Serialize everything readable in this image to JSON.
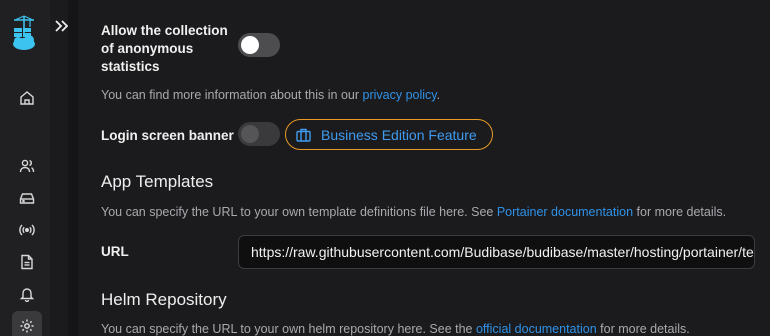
{
  "sidebar": {
    "icons": [
      "logo-icon",
      "home-icon",
      "users-icon",
      "environments-icon",
      "registries-icon",
      "logs-icon",
      "notifications-icon",
      "settings-icon"
    ]
  },
  "settings": {
    "anon_stats_label_line1": "Allow the collection",
    "anon_stats_label_line2": "of anonymous",
    "anon_stats_label_line3": "statistics",
    "anon_stats_enabled": false,
    "privacy_text": "You can find more information about this in our ",
    "privacy_link": "privacy policy",
    "privacy_suffix": ".",
    "login_banner_label": "Login screen banner",
    "login_banner_enabled": false,
    "business_edition_label": "Business Edition Feature"
  },
  "templates": {
    "title": "App Templates",
    "desc_prefix": "You can specify the URL to your own template definitions file here. See ",
    "desc_link": "Portainer documentation",
    "desc_suffix": " for more details.",
    "url_label": "URL",
    "url_value": "https://raw.githubusercontent.com/Budibase/budibase/master/hosting/portainer/template.json"
  },
  "helm": {
    "title": "Helm Repository",
    "desc_prefix": "You can specify the URL to your own helm repository here. See the ",
    "desc_link": "official documentation",
    "desc_suffix": " for more details."
  },
  "colors": {
    "accent": "#2f92e8",
    "business_border": "#e89a24",
    "logo": "#3cc3ef"
  }
}
